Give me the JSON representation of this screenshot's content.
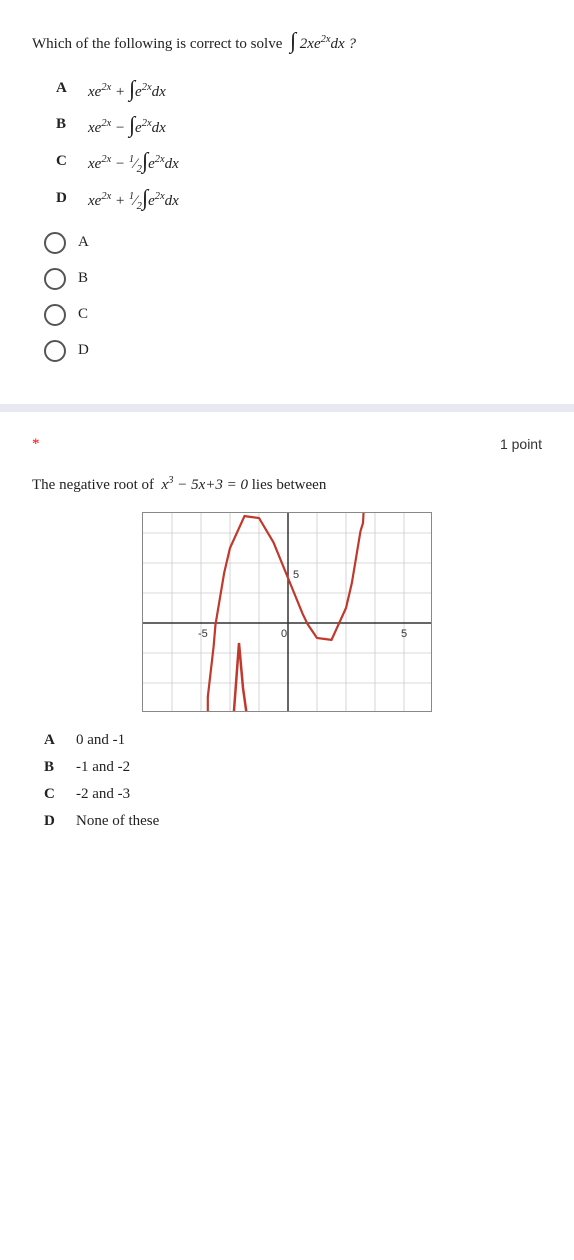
{
  "question1": {
    "text": "Which of the following is correct to solve",
    "integral_expr": "∫ 2xe²ˣ dx ?",
    "options": [
      {
        "label": "A",
        "html": "xe<sup>2x</sup> + ∫e<sup>2x</sup> dx"
      },
      {
        "label": "B",
        "html": "xe<sup>2x</sup> − ∫e<sup>2x</sup> dx"
      },
      {
        "label": "C",
        "html": "xe<sup>2x</sup> − ½∫e<sup>2x</sup> dx"
      },
      {
        "label": "D",
        "html": "xe<sup>2x</sup> + ½∫e<sup>2x</sup> dx"
      }
    ],
    "radio_options": [
      "A",
      "B",
      "C",
      "D"
    ]
  },
  "question2": {
    "asterisk": "*",
    "points": "1 point",
    "text": "The negative root of",
    "equation": "x³ − 5x+3 = 0",
    "text2": "lies between",
    "options": [
      {
        "label": "A",
        "text": "0 and -1"
      },
      {
        "label": "B",
        "text": "-1 and -2"
      },
      {
        "label": "C",
        "text": "-2 and -3"
      },
      {
        "label": "D",
        "text": "None of these"
      }
    ]
  }
}
